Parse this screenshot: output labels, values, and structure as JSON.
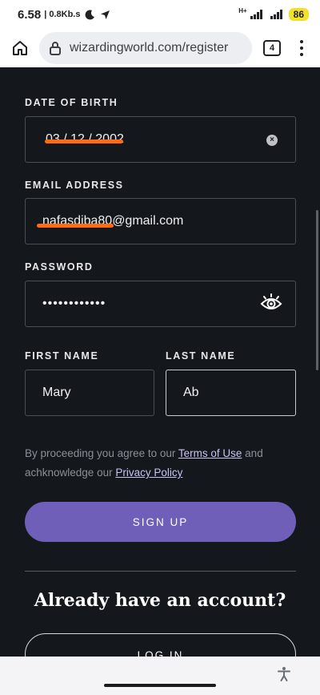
{
  "status_bar": {
    "time": "6.58",
    "speed": "0.8Kb.s",
    "network_label": "H+",
    "battery": "86"
  },
  "browser": {
    "url": "wizardingworld.com/register",
    "tab_count": "4"
  },
  "form": {
    "dob_label": "DATE OF BIRTH",
    "dob_value": "03 / 12 / 2002",
    "email_label": "EMAIL ADDRESS",
    "email_value": "nafasdiba80@gmail.com",
    "password_label": "PASSWORD",
    "password_value": "••••••••••••",
    "first_name_label": "FIRST NAME",
    "first_name_value": "Mary",
    "last_name_label": "LAST NAME",
    "last_name_value": "Ab"
  },
  "terms": {
    "prefix": "By proceeding you agree to our ",
    "terms_link": "Terms of Use",
    "middle": " and achknowledge our ",
    "privacy_link": "Privacy Policy"
  },
  "signup_label": "SIGN UP",
  "login_prompt": "Already have an account?",
  "login_label": "LOG IN",
  "colors": {
    "page_bg": "#14171c",
    "button_purple": "#6f5fb8",
    "redaction": "#ff6a13",
    "battery": "#f2e12b"
  },
  "icons": [
    "moon-icon",
    "navigation-icon",
    "signal-icon",
    "battery-icon",
    "home-icon",
    "lock-icon",
    "tabs-icon",
    "menu-icon",
    "clear-icon",
    "eye-icon",
    "accessibility-icon"
  ]
}
